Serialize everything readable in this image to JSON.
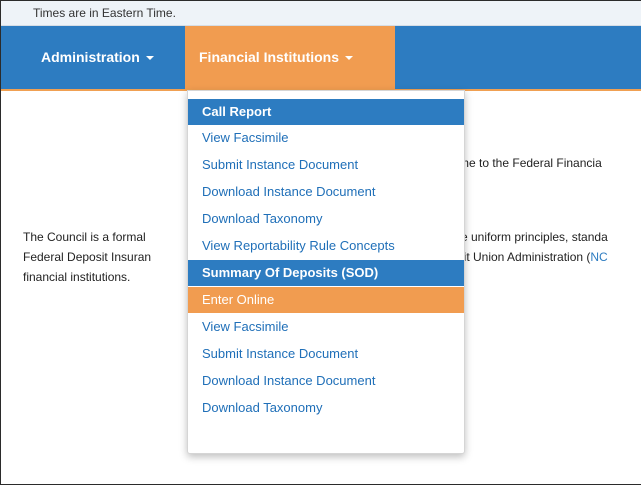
{
  "topbar": {
    "timezone_notice": "Times are in Eastern Time."
  },
  "nav": {
    "items": [
      {
        "label": "Administration",
        "active": false
      },
      {
        "label": "Financial Institutions",
        "active": true
      }
    ]
  },
  "dropdown": {
    "groups": [
      {
        "header": "Call Report",
        "items": [
          "View Facsimile",
          "Submit Instance Document",
          "Download Instance Document",
          "Download Taxonomy",
          "View Reportability Rule Concepts"
        ]
      },
      {
        "header": "Summary Of Deposits (SOD)",
        "items": [
          "Enter Online",
          "View Facsimile",
          "Submit Instance Document",
          "Download Instance Document",
          "Download Taxonomy"
        ],
        "highlighted_item": "Enter Online"
      }
    ]
  },
  "page": {
    "welcome_fragment": "me to the Federal Financia",
    "paragraph_left_lines": [
      "The Council is a formal",
      "Federal Deposit Insuran",
      "financial institutions."
    ],
    "paragraph_right_line1": "e uniform principles, standa",
    "paragraph_right_line2": "lit Union Administration (",
    "paragraph_right_link": "NC"
  },
  "colors": {
    "navbar": "#2d7cc1",
    "accent_orange": "#f19c50",
    "link": "#1f6fb8",
    "topbar_bg": "#eef3f8"
  }
}
